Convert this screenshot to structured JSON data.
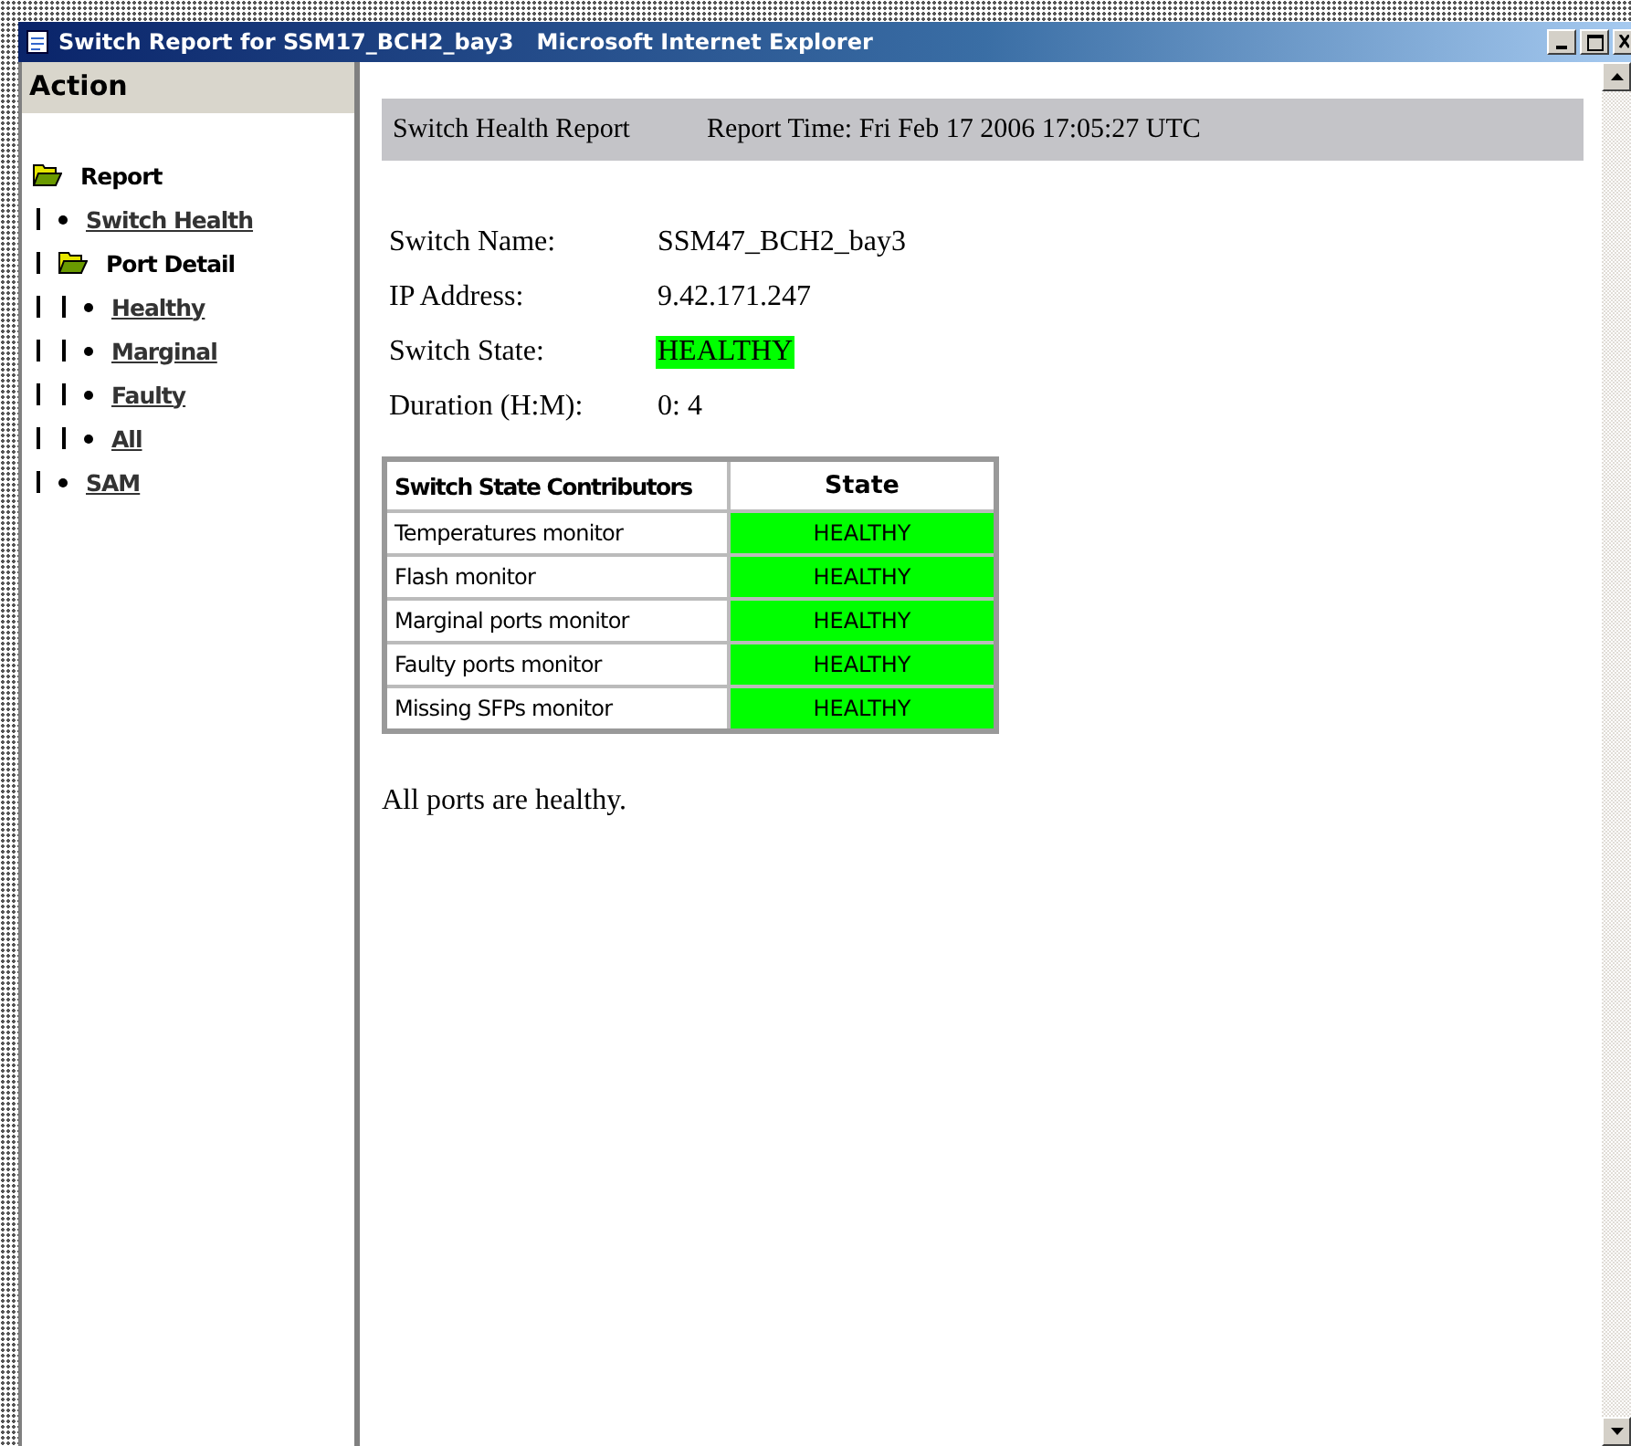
{
  "window": {
    "title": "Switch Report for SSM17_BCH2_bay3   Microsoft Internet Explorer"
  },
  "sidebar": {
    "heading": "Action",
    "tree": [
      {
        "label": "Report",
        "kind": "folder",
        "children": [
          {
            "label": "Switch Health",
            "kind": "link"
          },
          {
            "label": "Port Detail",
            "kind": "folder",
            "children": [
              {
                "label": "Healthy",
                "kind": "link"
              },
              {
                "label": "Marginal",
                "kind": "link"
              },
              {
                "label": "Faulty",
                "kind": "link"
              },
              {
                "label": "All",
                "kind": "link"
              }
            ]
          },
          {
            "label": "SAM",
            "kind": "link"
          }
        ]
      }
    ]
  },
  "report": {
    "title": "Switch Health Report",
    "time": "Report Time: Fri Feb 17 2006 17:05:27 UTC",
    "fields": [
      {
        "label": "Switch Name:",
        "value": "SSM47_BCH2_bay3"
      },
      {
        "label": "IP Address:",
        "value": "9.42.171.247"
      },
      {
        "label": "Switch State:",
        "value": "HEALTHY",
        "color": "#00ff00"
      },
      {
        "label": "Duration (H:M):",
        "value": "0: 4"
      }
    ],
    "table": {
      "columns": [
        "Switch State Contributors",
        "State"
      ],
      "rows": [
        {
          "name": "Temperatures monitor",
          "state": "HEALTHY",
          "color": "#00ff00"
        },
        {
          "name": "Flash monitor",
          "state": "HEALTHY",
          "color": "#00ff00"
        },
        {
          "name": "Marginal ports monitor",
          "state": "HEALTHY",
          "color": "#00ff00"
        },
        {
          "name": "Faulty ports monitor",
          "state": "HEALTHY",
          "color": "#00ff00"
        },
        {
          "name": "Missing SFPs monitor",
          "state": "HEALTHY",
          "color": "#00ff00"
        }
      ]
    },
    "message": "All ports are healthy."
  }
}
